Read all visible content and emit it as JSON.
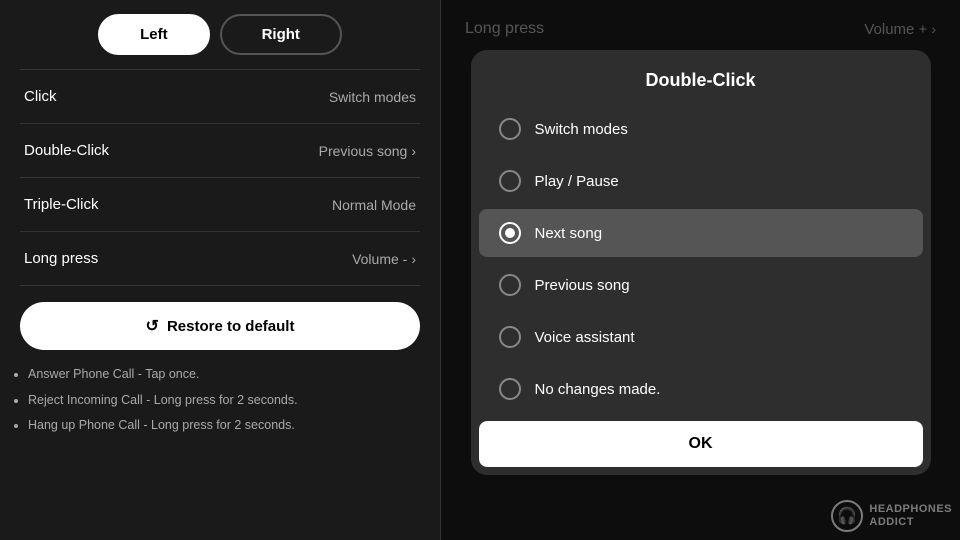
{
  "tabs": {
    "left_label": "Left",
    "right_label": "Right",
    "active": "left"
  },
  "menu": {
    "click": {
      "label": "Click",
      "value": "Switch modes"
    },
    "double_click": {
      "label": "Double-Click",
      "value": "Previous song",
      "has_chevron": true
    },
    "triple_click": {
      "label": "Triple-Click",
      "value": "Normal Mode"
    },
    "long_press": {
      "label": "Long press",
      "value": "Volume -",
      "has_chevron": true
    }
  },
  "restore_button": "Restore to default",
  "info_items": [
    "Answer Phone Call - Tap once.",
    "Reject Incoming Call - Long press for 2 seconds.",
    "Hang up Phone Call - Long press for 2 seconds."
  ],
  "right_header": {
    "label": "Long press",
    "value": "Volume +",
    "has_chevron": true
  },
  "modal": {
    "title": "Double-Click",
    "options": [
      {
        "label": "Switch modes",
        "selected": false
      },
      {
        "label": "Play / Pause",
        "selected": false
      },
      {
        "label": "Next song",
        "selected": true
      },
      {
        "label": "Previous song",
        "selected": false
      },
      {
        "label": "Voice assistant",
        "selected": false
      },
      {
        "label": "No changes made.",
        "selected": false
      }
    ],
    "ok_label": "OK"
  },
  "watermark": {
    "icon": "🎧",
    "line1": "HEADPHONES",
    "line2": "ADDICT"
  }
}
